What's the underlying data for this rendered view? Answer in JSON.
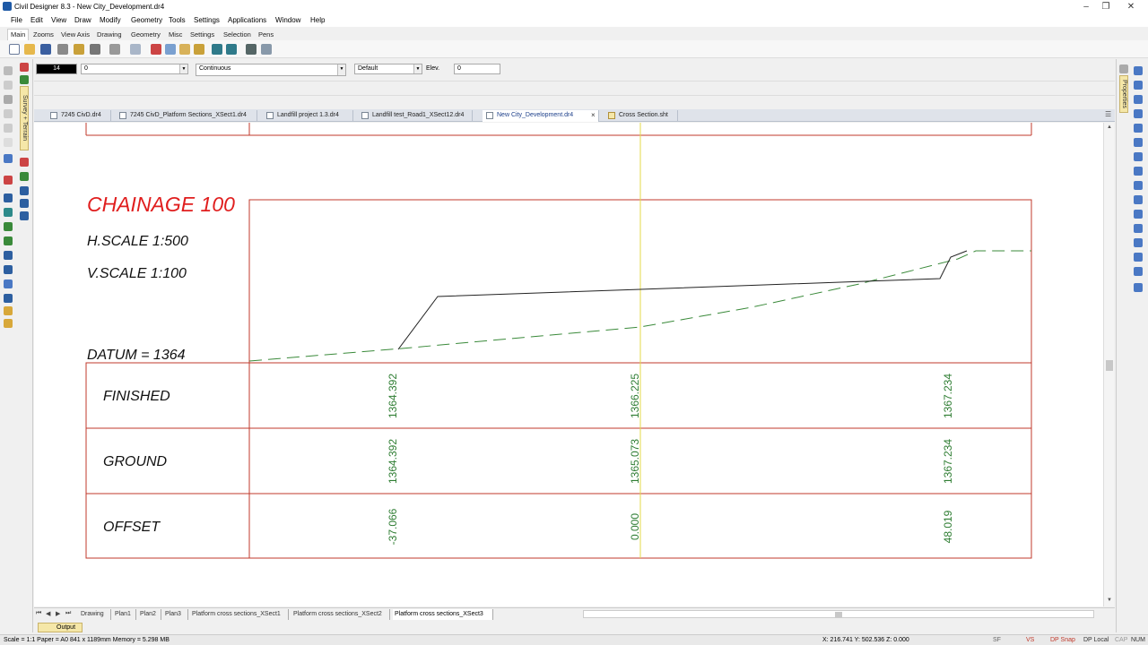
{
  "window": {
    "title": "Civil Designer 8.3 - New City_Development.dr4"
  },
  "menu": [
    "File",
    "Edit",
    "View",
    "Draw",
    "Modify",
    "Geometry",
    "Tools",
    "Settings",
    "Applications",
    "Window",
    "Help"
  ],
  "ribbon_tabs": [
    "Main",
    "Zooms",
    "View Axis",
    "Drawing",
    "Geometry",
    "Misc",
    "Settings",
    "Selection",
    "Pens"
  ],
  "props": {
    "color_value": "14",
    "layer_value": "0",
    "linetype_value": "Continuous",
    "style_value": "Default",
    "elev_label": "Elev.",
    "elev_value": "0"
  },
  "left_vertical_tab": "Survey + Terrain",
  "right_vertical_tab": "Properties",
  "doc_tabs": [
    "7245 CivD.dr4",
    "7245 CivD_Platform Sections_XSect1.dr4",
    "Landfill project 1.3.dr4",
    "Landfill test_Road1_XSect12.dr4",
    "New City_Development.dr4",
    "Cross Section.sht"
  ],
  "drawing": {
    "chainage": "CHAINAGE 100",
    "hscale": "H.SCALE 1:500",
    "vscale": "V.SCALE 1:100",
    "datum": "DATUM = 1364",
    "rows": [
      "FINISHED",
      "GROUND",
      "OFFSET"
    ],
    "finished": [
      "1364.392",
      "1366.225",
      "1367.234"
    ],
    "ground": [
      "1364.392",
      "1365.073",
      "1367.234"
    ],
    "offset": [
      "-37.066",
      "0.000",
      "48.019"
    ]
  },
  "sheet_tabs": [
    "Drawing",
    "Plan1",
    "Plan2",
    "Plan3",
    "Platform cross sections_XSect1",
    "Platform cross sections_XSect2",
    "Platform cross sections_XSect3"
  ],
  "output_tab": "Output",
  "status": {
    "left": "Scale = 1:1   Paper = A0 841 x 1189mm   Memory = 5.298 MB",
    "coords": "X: 216.741  Y: 502.536  Z: 0.000",
    "sf": "SF",
    "vs": "VS",
    "dpsnap": "DP Snap",
    "dplocal": "DP Local",
    "cap": "CAP",
    "num": "NUM"
  },
  "colors": {
    "frame_red": "#c0392b",
    "chainage_red": "#e01e1e",
    "value_green": "#2e7d32",
    "ground_green": "#3a8a3a",
    "centerline_yellow": "#e6d84a",
    "accent_blue": "#1c3f8a"
  }
}
